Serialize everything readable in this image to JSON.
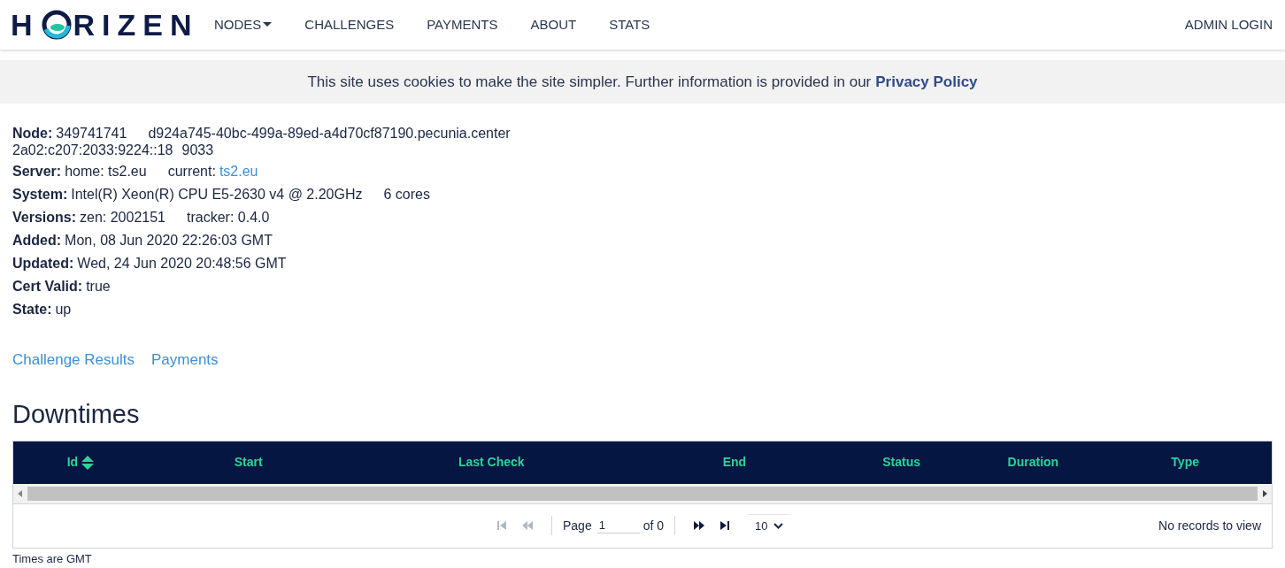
{
  "nav": {
    "logo": "H RIZEN",
    "items": [
      {
        "label": "NODES",
        "dropdown": true
      },
      {
        "label": "CHALLENGES",
        "dropdown": false
      },
      {
        "label": "PAYMENTS",
        "dropdown": false
      },
      {
        "label": "ABOUT",
        "dropdown": false
      },
      {
        "label": "STATS",
        "dropdown": false
      }
    ],
    "admin": "ADMIN LOGIN"
  },
  "cookie_banner": {
    "text": "This site uses cookies to make the site simpler. Further information is provided in our",
    "link": "Privacy Policy"
  },
  "details": [
    {
      "label": "Node:",
      "values": [
        {
          "kind": "text",
          "text": "349741741"
        },
        {
          "kind": "text",
          "text": "d924a745-40bc-499a-89ed-a4d70cf87190.pecunia.center"
        }
      ],
      "second_line": [
        "2a02:c207:2033:9224::18",
        "9033"
      ]
    },
    {
      "label": "Server:",
      "values": [
        {
          "kind": "text",
          "text": "home: ts2.eu"
        },
        {
          "kind": "text",
          "text": "current:"
        },
        {
          "kind": "link",
          "text": "ts2.eu"
        }
      ]
    },
    {
      "label": "System:",
      "values": [
        {
          "kind": "text",
          "text": "Intel(R) Xeon(R) CPU E5-2630 v4 @ 2.20GHz"
        },
        {
          "kind": "text",
          "text": "6 cores"
        }
      ]
    },
    {
      "label": "Versions:",
      "values": [
        {
          "kind": "text",
          "text": "zen: 2002151"
        },
        {
          "kind": "text",
          "text": "tracker: 0.4.0"
        }
      ]
    },
    {
      "label": "Added:",
      "values": [
        {
          "kind": "text",
          "text": "Mon, 08 Jun 2020 22:26:03 GMT"
        }
      ]
    },
    {
      "label": "Updated:",
      "values": [
        {
          "kind": "text",
          "text": "Wed, 24 Jun 2020 20:48:56 GMT"
        }
      ]
    },
    {
      "label": "Cert Valid:",
      "values": [
        {
          "kind": "text",
          "text": "true"
        }
      ]
    },
    {
      "label": "State:",
      "values": [
        {
          "kind": "text",
          "text": "up"
        }
      ]
    }
  ],
  "links": [
    "Challenge Results",
    "Payments"
  ],
  "downtimes": {
    "title": "Downtimes",
    "columns": [
      {
        "label": "Id",
        "sortable": true
      },
      {
        "label": "Start",
        "sortable": false
      },
      {
        "label": "Last Check",
        "sortable": false
      },
      {
        "label": "End",
        "sortable": false
      },
      {
        "label": "Status",
        "sortable": false
      },
      {
        "label": "Duration",
        "sortable": false
      },
      {
        "label": "Type",
        "sortable": false
      }
    ],
    "pager": {
      "first_disabled": true,
      "prev_disabled": true,
      "next_disabled": false,
      "last_disabled": false,
      "page_label": "Page",
      "page_value": "1",
      "of_label": "of 0",
      "page_size": "10",
      "records": "No records to view"
    },
    "footnote": "Times are GMT"
  }
}
